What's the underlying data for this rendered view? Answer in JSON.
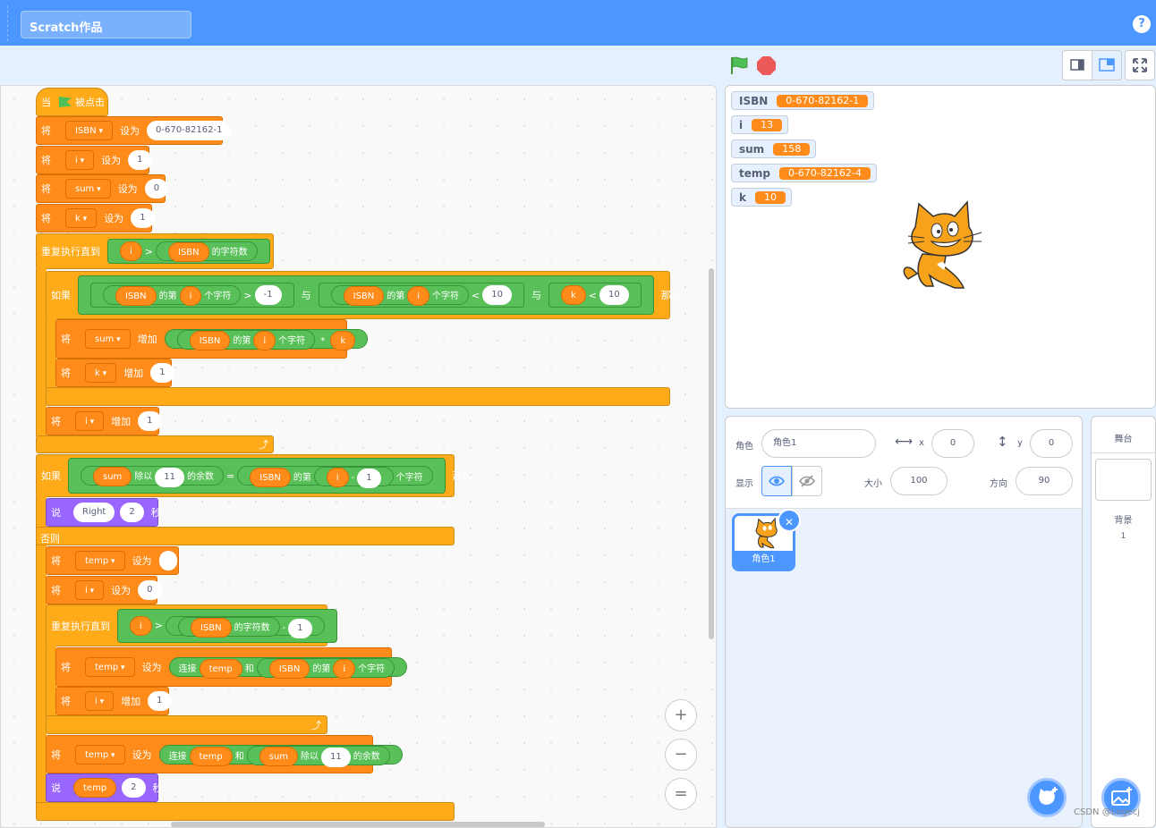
{
  "menu": {
    "project_title": "Scratch作品",
    "help": "?"
  },
  "stage_monitors": [
    {
      "name": "ISBN",
      "value": "0-670-82162-1"
    },
    {
      "name": "i",
      "value": "13"
    },
    {
      "name": "sum",
      "value": "158"
    },
    {
      "name": "temp",
      "value": "0-670-82162-4"
    },
    {
      "name": "k",
      "value": "10"
    }
  ],
  "blocks": {
    "hat_when": "当",
    "hat_clicked": "被点击",
    "set": "将",
    "set_to": "设为",
    "change_by": "增加",
    "isbn": "ISBN",
    "isbn_value": "0-670-82162-1",
    "i": "i",
    "sum": "sum",
    "k": "k",
    "temp": "temp",
    "one": "1",
    "zero": "0",
    "neg_one": "-1",
    "ten": "10",
    "eleven": "11",
    "two": "2",
    "repeat_until": "重复执行直到",
    "length_of": "的字符数",
    "if": "如果",
    "then": "那么",
    "else": "否则",
    "letter_of": "的第",
    "char": "个字符",
    "gt": ">",
    "lt": "<",
    "and": "与",
    "eq": "=",
    "minus": "-",
    "times": "*",
    "mod": "除以",
    "remainder": "的余数",
    "join": "连接",
    "join_and": "和",
    "say": "说",
    "say_secs": "秒",
    "right": "Right"
  },
  "zoom": {
    "in": "+",
    "out": "−",
    "reset": "="
  },
  "sprite_info": {
    "sprite_label": "角色",
    "sprite_name": "角色1",
    "x_label": "x",
    "x": "0",
    "y_label": "y",
    "y": "0",
    "show_label": "显示",
    "size_label": "大小",
    "size": "100",
    "direction_label": "方向",
    "direction": "90"
  },
  "sprite_list": [
    {
      "name": "角色1"
    }
  ],
  "stage_panel": {
    "title": "舞台",
    "backdrops_label": "背景",
    "backdrops_count": "1"
  },
  "watermark": "CSDN @Logecj"
}
